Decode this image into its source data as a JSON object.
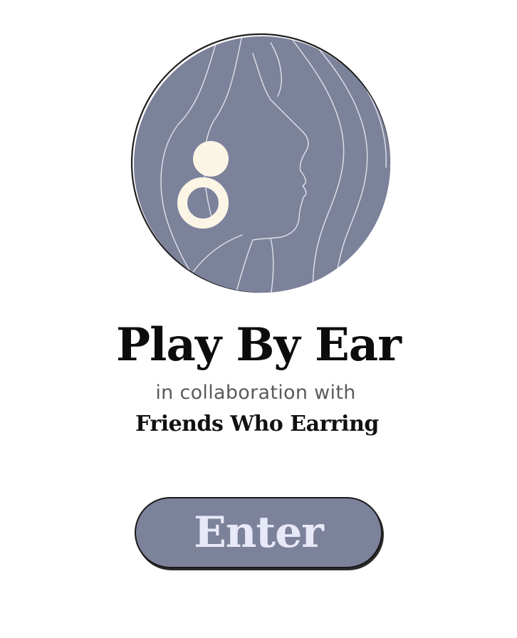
{
  "app": {
    "title": "Play By Ear",
    "collab_text": "in collaboration with",
    "partner_name": "Friends Who Earring"
  },
  "actions": {
    "enter_label": "Enter"
  },
  "logo": {
    "icon": "woman-profile-earring-icon"
  },
  "colors": {
    "circle_fill": "#7d829b",
    "earring": "#fbf5e6",
    "button_fill": "#7d829b",
    "button_text": "#e8e9f8",
    "title_text": "#0c0c0c"
  }
}
